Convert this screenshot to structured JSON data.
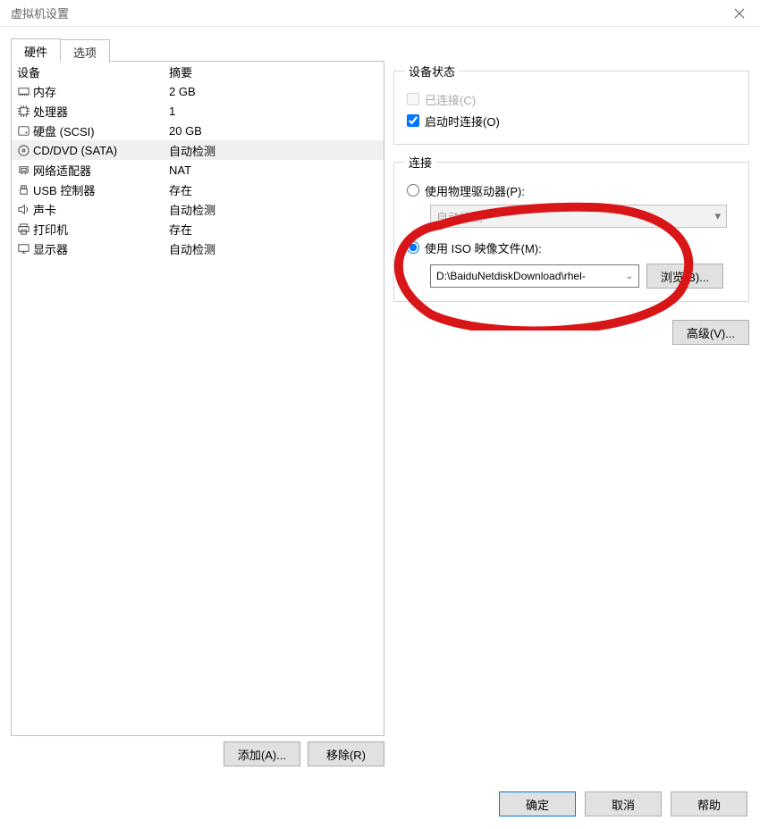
{
  "window": {
    "title": "虚拟机设置"
  },
  "tabs": {
    "hardware": "硬件",
    "options": "选项"
  },
  "listHeader": {
    "device": "设备",
    "summary": "摘要"
  },
  "hardware": [
    {
      "id": 0,
      "icon": "memory",
      "label": "内存",
      "summary": "2 GB"
    },
    {
      "id": 1,
      "icon": "cpu",
      "label": "处理器",
      "summary": "1"
    },
    {
      "id": 2,
      "icon": "disk",
      "label": "硬盘 (SCSI)",
      "summary": "20 GB"
    },
    {
      "id": 3,
      "icon": "cd",
      "label": "CD/DVD (SATA)",
      "summary": "自动检测"
    },
    {
      "id": 4,
      "icon": "net",
      "label": "网络适配器",
      "summary": "NAT"
    },
    {
      "id": 5,
      "icon": "usb",
      "label": "USB 控制器",
      "summary": "存在"
    },
    {
      "id": 6,
      "icon": "sound",
      "label": "声卡",
      "summary": "自动检测"
    },
    {
      "id": 7,
      "icon": "printer",
      "label": "打印机",
      "summary": "存在"
    },
    {
      "id": 8,
      "icon": "display",
      "label": "显示器",
      "summary": "自动检测"
    }
  ],
  "selectedHardware": 3,
  "leftButtons": {
    "add": "添加(A)...",
    "remove": "移除(R)"
  },
  "rightPanel": {
    "deviceStatus": {
      "legend": "设备状态",
      "connected": "已连接(C)",
      "connectAtPowerOn": "启动时连接(O)"
    },
    "connection": {
      "legend": "连接",
      "usePhysical": "使用物理驱动器(P):",
      "physicalValue": "自动检测",
      "useIso": "使用 ISO 映像文件(M):",
      "isoPath": "D:\\BaiduNetdiskDownload\\rhel-",
      "browse": "浏览(B)..."
    },
    "advanced": "高级(V)..."
  },
  "dialogButtons": {
    "ok": "确定",
    "cancel": "取消",
    "help": "帮助"
  }
}
